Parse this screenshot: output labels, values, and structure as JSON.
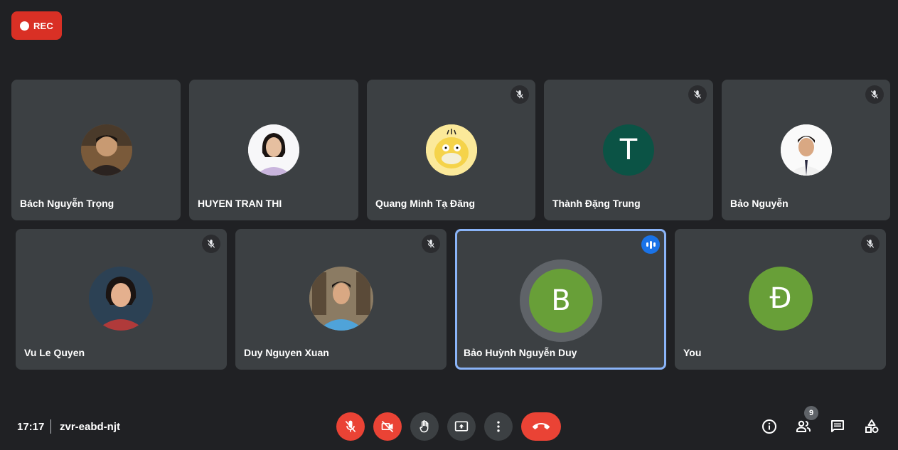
{
  "recording": {
    "label": "REC"
  },
  "participants": [
    {
      "name": "Bách Nguyễn Trọng",
      "muted": false,
      "avatar": "photo"
    },
    {
      "name": "HUYEN TRAN THI",
      "muted": false,
      "avatar": "photo"
    },
    {
      "name": "Quang Minh Tạ Đăng",
      "muted": true,
      "avatar": "photo"
    },
    {
      "name": "Thành Đặng Trung",
      "muted": true,
      "avatar": "T",
      "avatar_color": "#0b5345"
    },
    {
      "name": "Bảo Nguyễn",
      "muted": true,
      "avatar": "photo"
    },
    {
      "name": "Vu Le Quyen",
      "muted": true,
      "avatar": "photo"
    },
    {
      "name": "Duy Nguyen Xuan",
      "muted": true,
      "avatar": "photo"
    },
    {
      "name": "Bảo Huỳnh Nguyễn Duy",
      "muted": false,
      "speaking": true,
      "avatar": "B",
      "avatar_color": "#689f38"
    },
    {
      "name": "You",
      "muted": true,
      "avatar": "Đ",
      "avatar_color": "#689f38"
    }
  ],
  "bottom_bar": {
    "time": "17:17",
    "meeting_code": "zvr-eabd-njt",
    "controls": [
      "mic-off-icon",
      "camera-off-icon",
      "raise-hand-icon",
      "present-screen-icon",
      "more-options-icon",
      "end-call-icon"
    ],
    "right_icons": [
      "info-icon",
      "people-icon",
      "chat-icon",
      "activities-icon"
    ],
    "people_count": "9"
  },
  "colors": {
    "background": "#202124",
    "tile": "#3c4043",
    "red": "#ea4335",
    "speaking_border": "#8ab4f8"
  }
}
